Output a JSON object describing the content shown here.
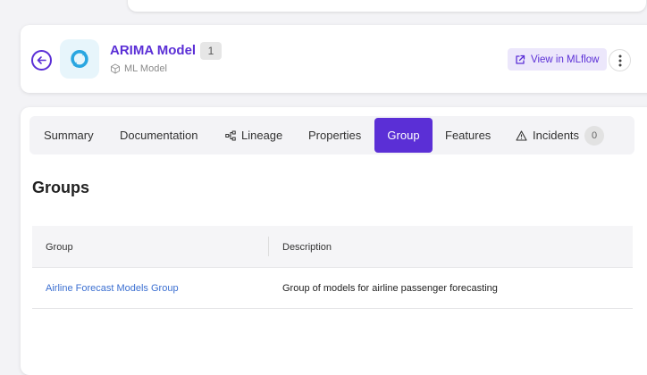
{
  "header": {
    "title": "ARIMA Model",
    "version": "1",
    "subtype": "ML Model",
    "view_button": "View in MLflow"
  },
  "tabs": [
    {
      "label": "Summary"
    },
    {
      "label": "Documentation"
    },
    {
      "label": "Lineage"
    },
    {
      "label": "Properties"
    },
    {
      "label": "Group",
      "active": true
    },
    {
      "label": "Features"
    },
    {
      "label": "Incidents",
      "count": "0"
    }
  ],
  "section": {
    "title": "Groups"
  },
  "table": {
    "columns": [
      "Group",
      "Description"
    ],
    "rows": [
      {
        "group": "Airline Forecast Models Group",
        "description": "Group of models for airline passenger forecasting"
      }
    ]
  },
  "colors": {
    "accent": "#5b2fd6",
    "link": "#3b6fd1"
  },
  "icons": [
    "back-arrow-icon",
    "mlflow-logo-icon",
    "cube-icon",
    "external-link-icon",
    "more-vertical-icon",
    "lineage-icon",
    "warning-icon"
  ]
}
